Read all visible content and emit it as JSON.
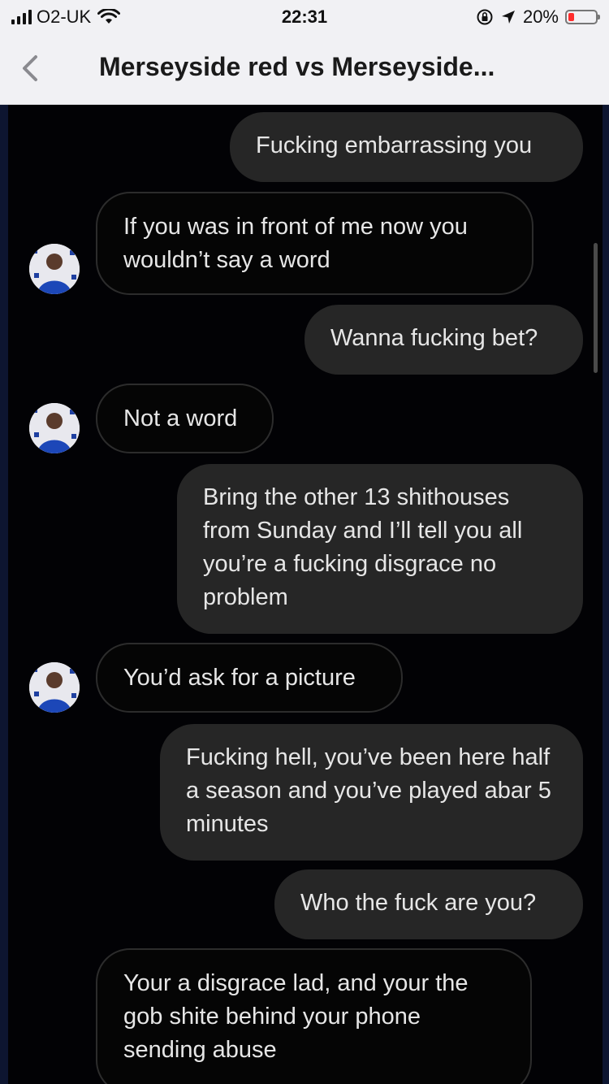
{
  "status_bar": {
    "carrier": "O2-UK",
    "time": "22:31",
    "battery": "20%",
    "battery_level": 0.2,
    "icons": [
      "signal-icon",
      "wifi-icon",
      "rotation-lock-icon",
      "location-icon",
      "battery-icon"
    ]
  },
  "header": {
    "title": "Merseyside red vs Merseyside..."
  },
  "messages": [
    {
      "side": "out",
      "text": "Fucking embarrassing you"
    },
    {
      "side": "in",
      "text": "If you was in front of me now you wouldn’t say a word"
    },
    {
      "side": "out",
      "text": "Wanna fucking bet?"
    },
    {
      "side": "in",
      "text": "Not a word"
    },
    {
      "side": "out",
      "text": "Bring the other 13 shithouses from Sunday and I’ll tell you all you’re a fucking disgrace no problem"
    },
    {
      "side": "in",
      "text": "You’d ask for a picture"
    },
    {
      "side": "out",
      "text": "Fucking hell, you’ve been here half a season and you’ve played abar 5 minutes"
    },
    {
      "side": "out",
      "text": "Who the fuck are you?"
    },
    {
      "side": "in",
      "text": "Your a disgrace lad, and your the gob shite behind your phone sending abuse"
    }
  ],
  "colors": {
    "chat_background": "#020205",
    "outgoing_bubble": "#262626",
    "incoming_border": "#2c2c2c",
    "text": "#e6e6e6",
    "battery_low": "#ff2d2d"
  }
}
